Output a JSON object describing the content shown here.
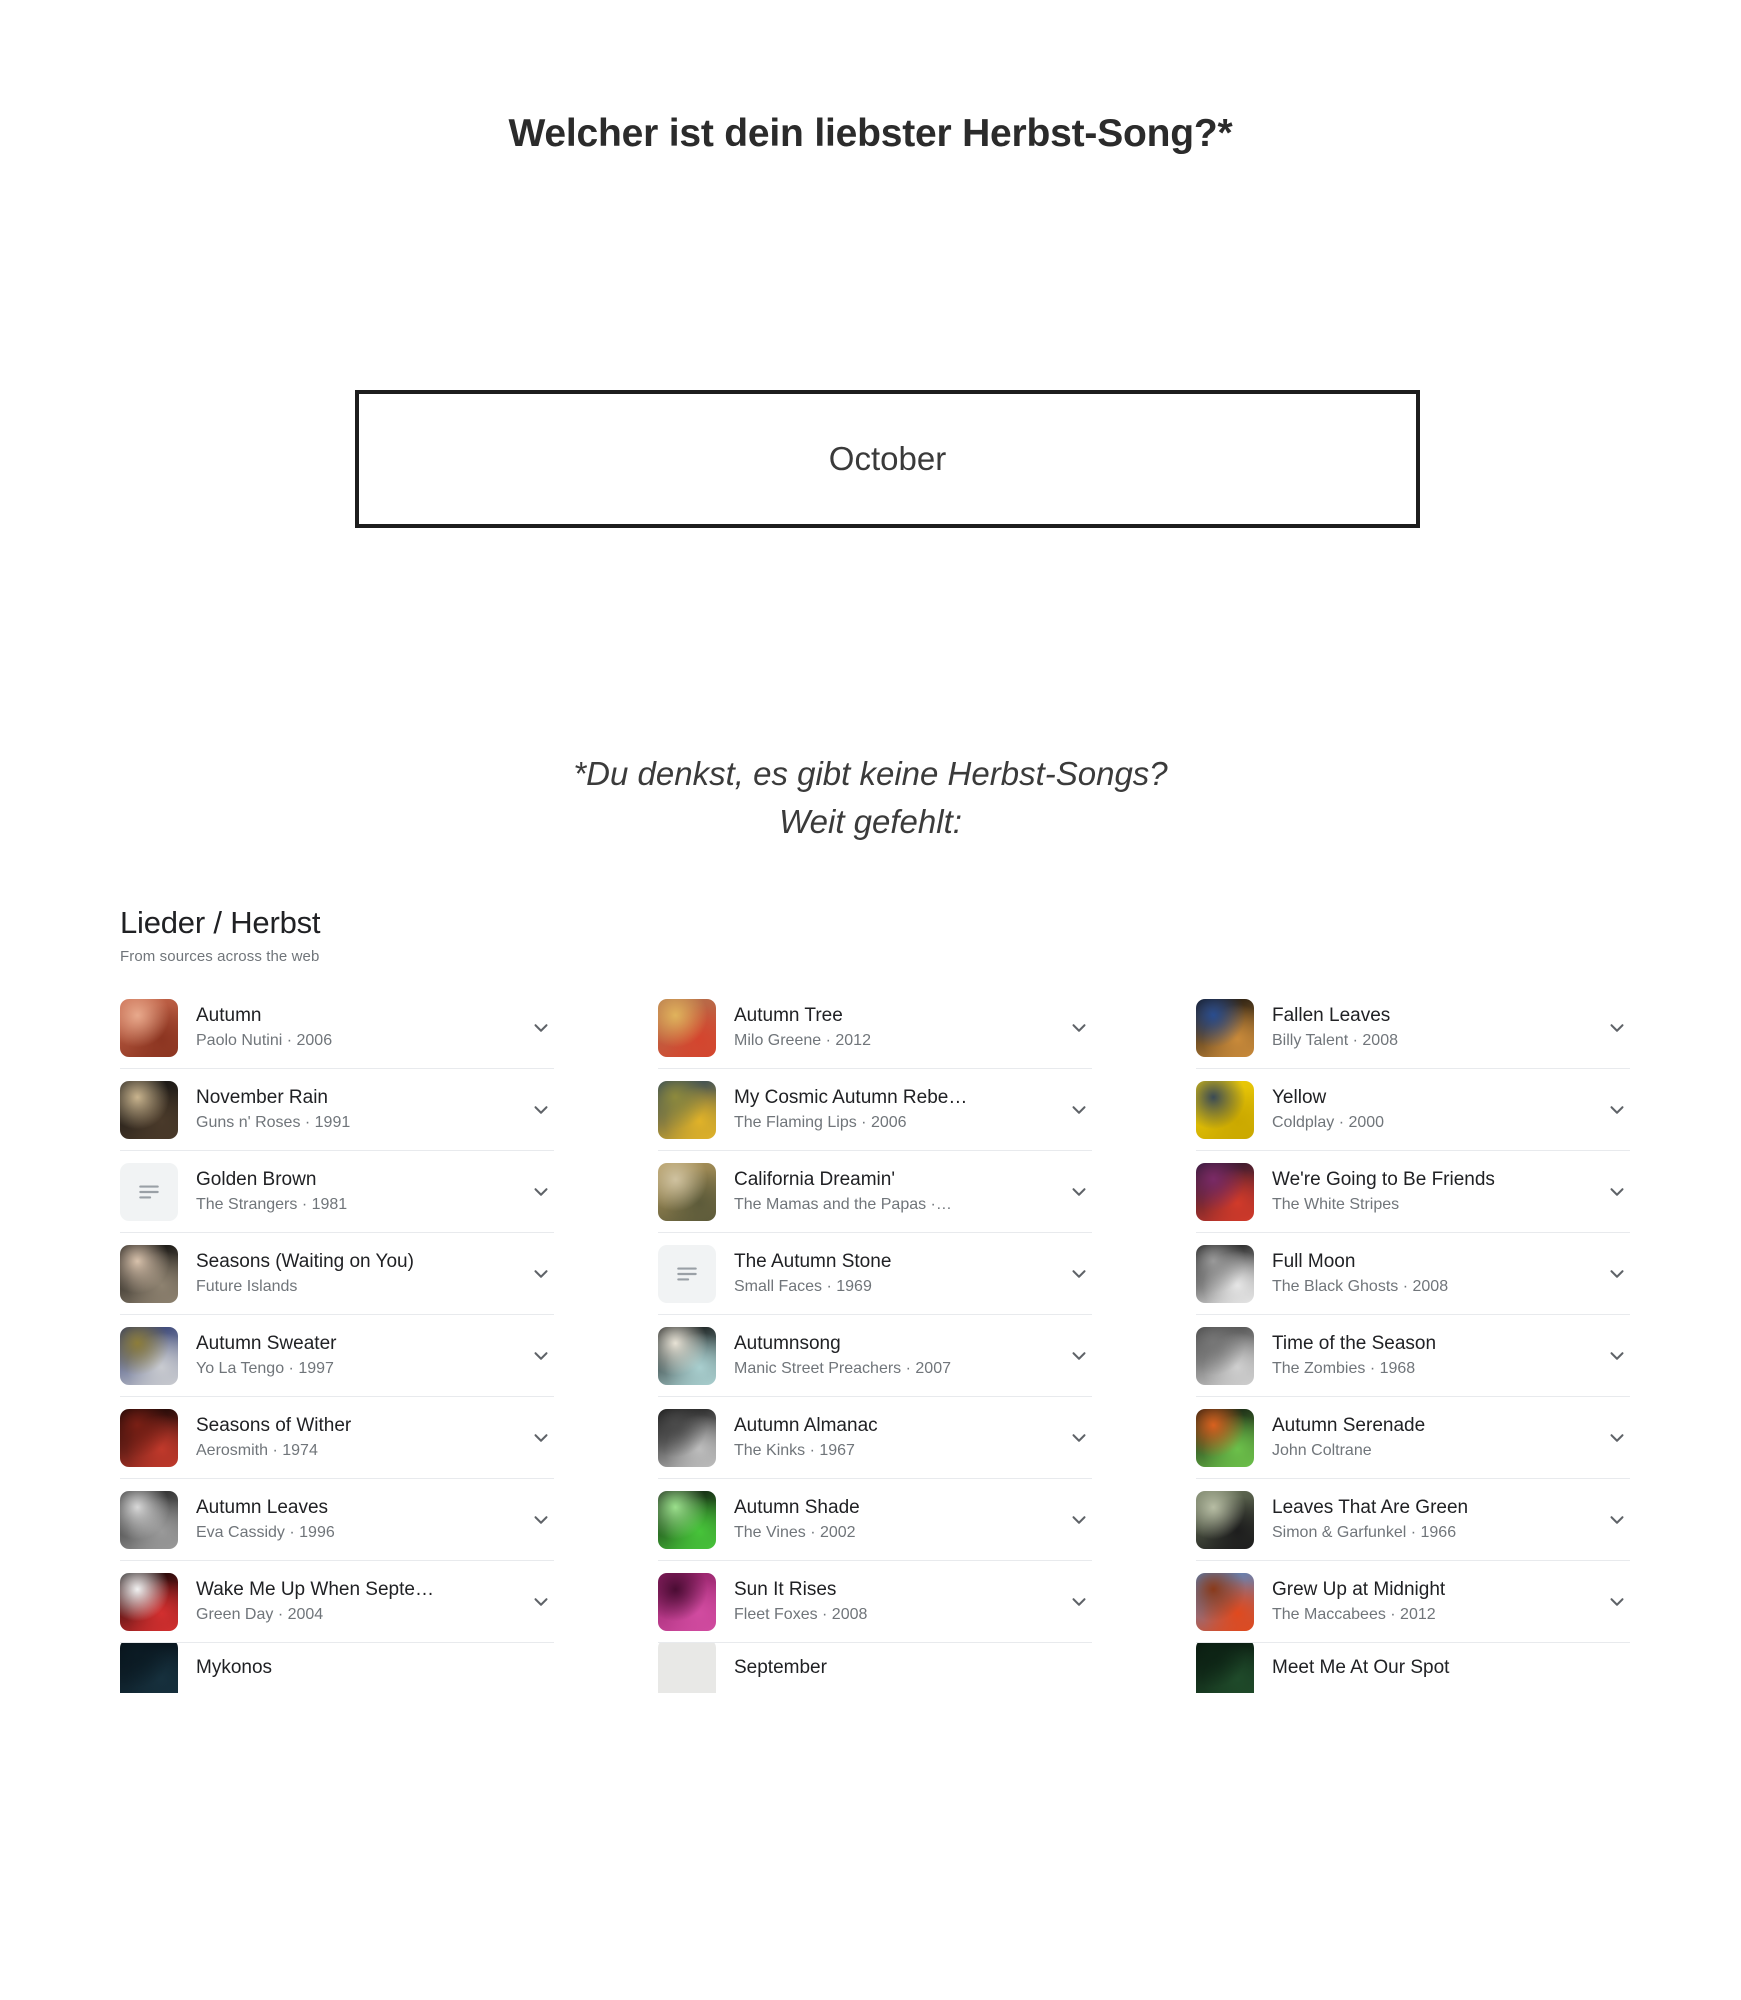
{
  "question": {
    "title": "Welcher ist dein liebster Herbst-Song?*",
    "answer_value": "October"
  },
  "note": {
    "line1": "*Du denkst, es gibt keine Herbst-Songs?",
    "line2": "Weit gefehlt:"
  },
  "results": {
    "title": "Lieder / Herbst",
    "subtitle": "From sources across the web",
    "columns": [
      {
        "songs": [
          {
            "title": "Autumn",
            "artist": "Paolo Nutini · 2006",
            "art": "photo",
            "colors": [
              "#c96a4e",
              "#8c3521",
              "#e8a98c"
            ]
          },
          {
            "title": "November Rain",
            "artist": "Guns n' Roses · 1991",
            "art": "photo",
            "colors": [
              "#111111",
              "#4a3a2a",
              "#c9b48e"
            ]
          },
          {
            "title": "Golden Brown",
            "artist": "The Strangers · 1981",
            "art": "placeholder",
            "colors": []
          },
          {
            "title": "Seasons (Waiting on You)",
            "artist": "Future Islands",
            "art": "photo",
            "colors": [
              "#000000",
              "#8e8270",
              "#d8c2ac"
            ]
          },
          {
            "title": "Autumn Sweater",
            "artist": "Yo La Tengo · 1997",
            "art": "photo",
            "colors": [
              "#1d2b66",
              "#c9cbd0",
              "#8d7d3a"
            ]
          },
          {
            "title": "Seasons of Wither",
            "artist": "Aerosmith · 1974",
            "art": "photo",
            "colors": [
              "#000000",
              "#c0392b",
              "#7a1f15"
            ]
          },
          {
            "title": "Autumn Leaves",
            "artist": "Eva Cassidy · 1996",
            "art": "photo",
            "colors": [
              "#1a1a1a",
              "#9a9a9a",
              "#d8d8d8"
            ]
          },
          {
            "title": "Wake Me Up When Septe…",
            "artist": "Green Day · 2004",
            "art": "photo",
            "colors": [
              "#000000",
              "#d32f2f",
              "#f2f2f2"
            ]
          },
          {
            "title": "Mykonos",
            "artist": "",
            "art": "photo",
            "colors": [
              "#050d14",
              "#16303d",
              "#0b1b24"
            ]
          }
        ]
      },
      {
        "songs": [
          {
            "title": "Autumn Tree",
            "artist": "Milo Greene · 2012",
            "art": "photo",
            "colors": [
              "#b0744f",
              "#d4452e",
              "#e0b35c"
            ]
          },
          {
            "title": "My Cosmic Autumn Rebe…",
            "artist": "The Flaming Lips · 2006",
            "art": "photo",
            "colors": [
              "#1c3a5e",
              "#e0b228",
              "#8e8a3c"
            ]
          },
          {
            "title": "California Dreamin'",
            "artist": "The Mamas and the Papas ·…",
            "art": "photo",
            "colors": [
              "#b59a5e",
              "#5d5b3a",
              "#cfc2a0"
            ]
          },
          {
            "title": "The Autumn Stone",
            "artist": "Small Faces · 1969",
            "art": "placeholder",
            "colors": []
          },
          {
            "title": "Autumnsong",
            "artist": "Manic Street Preachers · 2007",
            "art": "photo",
            "colors": [
              "#000000",
              "#a9cfcf",
              "#e8e3d6"
            ]
          },
          {
            "title": "Autumn Almanac",
            "artist": "The Kinks · 1967",
            "art": "photo",
            "colors": [
              "#0a0a0a",
              "#bdbdbd",
              "#4a4a4a"
            ]
          },
          {
            "title": "Autumn Shade",
            "artist": "The Vines · 2002",
            "art": "photo",
            "colors": [
              "#0b0b0b",
              "#47c43a",
              "#9be08c"
            ]
          },
          {
            "title": "Sun It Rises",
            "artist": "Fleet Foxes · 2008",
            "art": "photo",
            "colors": [
              "#8e1e63",
              "#d14ba0",
              "#4a0c33"
            ]
          },
          {
            "title": "September",
            "artist": "",
            "art": "placeholder-light",
            "colors": []
          }
        ]
      },
      {
        "songs": [
          {
            "title": "Fallen Leaves",
            "artist": "Billy Talent · 2008",
            "art": "photo",
            "colors": [
              "#0b0b0b",
              "#c98a3a",
              "#2a4d8f"
            ]
          },
          {
            "title": "Yellow",
            "artist": "Coldplay · 2000",
            "art": "photo",
            "colors": [
              "#f2d10a",
              "#caa800",
              "#3a4a55"
            ]
          },
          {
            "title": "We're Going to Be Friends",
            "artist": "The White Stripes",
            "art": "photo",
            "colors": [
              "#1a1430",
              "#d13a2a",
              "#7a2a66"
            ]
          },
          {
            "title": "Full Moon",
            "artist": "The Black Ghosts · 2008",
            "art": "photo",
            "colors": [
              "#000000",
              "#e6e6e6",
              "#9a9a9a"
            ]
          },
          {
            "title": "Time of the Season",
            "artist": "The Zombies · 1968",
            "art": "photo",
            "colors": [
              "#3a3a3a",
              "#cfcfcf",
              "#777777"
            ]
          },
          {
            "title": "Autumn Serenade",
            "artist": "John Coltrane",
            "art": "photo",
            "colors": [
              "#0a0a0a",
              "#6cc04a",
              "#d9611f"
            ]
          },
          {
            "title": "Leaves That Are Green",
            "artist": "Simon & Garfunkel · 1966",
            "art": "photo",
            "colors": [
              "#6f7a5e",
              "#1d1d1d",
              "#b7bda4"
            ]
          },
          {
            "title": "Grew Up at Midnight",
            "artist": "The Maccabees · 2012",
            "art": "photo",
            "colors": [
              "#4a8fd4",
              "#e0491d",
              "#8a3a1a"
            ]
          },
          {
            "title": "Meet Me At Our Spot",
            "artist": "",
            "art": "photo",
            "colors": [
              "#06110b",
              "#1f4a2a",
              "#0d2415"
            ]
          }
        ]
      }
    ]
  },
  "icons": {
    "chevron": "chevron-down-icon",
    "placeholder": "music-list-icon"
  }
}
